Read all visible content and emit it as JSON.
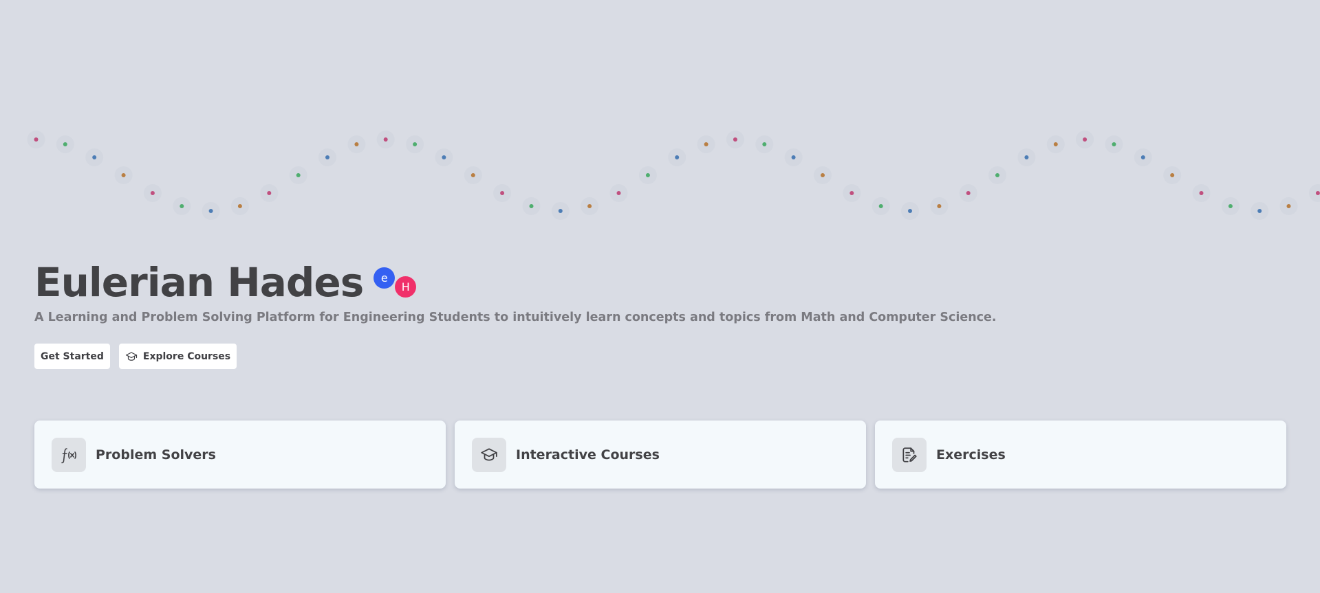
{
  "hero": {
    "title": "Eulerian Hades",
    "badge_e": "e",
    "badge_h": "H",
    "subtitle": "A Learning and Problem Solving Platform for Engineering Students to intuitively learn concepts and topics from Math and Computer Science."
  },
  "actions": {
    "get_started": "Get Started",
    "explore_courses": "Explore Courses",
    "explore_courses_icon": "graduation-cap-icon"
  },
  "cards": [
    {
      "label": "Problem Solvers",
      "icon": "function-icon"
    },
    {
      "label": "Interactive Courses",
      "icon": "graduation-cap-icon"
    },
    {
      "label": "Exercises",
      "icon": "document-edit-icon"
    }
  ],
  "colors": {
    "background": "#d9dce4",
    "badge_e": "#3460f2",
    "badge_h": "#f0306a",
    "wave_dots": [
      "#c0507f",
      "#4fae6f",
      "#4d7db5",
      "#b97f43"
    ]
  }
}
